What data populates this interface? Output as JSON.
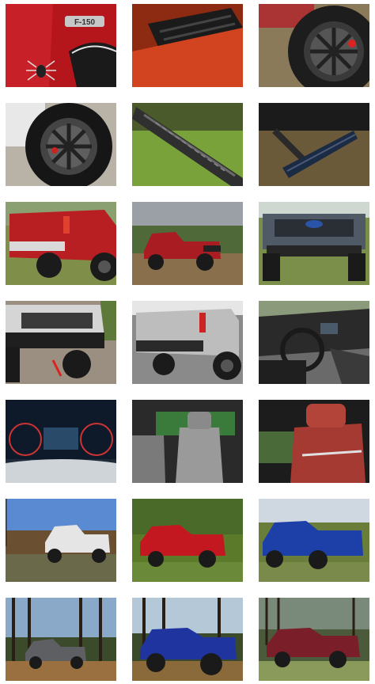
{
  "gallery": {
    "photos": [
      {
        "subject": "truck-fender-emblem",
        "badge": "F-150",
        "colors": {
          "paint": "#b5161c",
          "bg": "#6b1a12"
        }
      },
      {
        "subject": "hood-vent",
        "colors": {
          "paint": "#c4351b",
          "bg": "#7a2a10"
        }
      },
      {
        "subject": "wheel-tire",
        "colors": {
          "paint": "#2b2b2b",
          "bg": "#8a7a5a"
        }
      },
      {
        "subject": "wheel-closeup",
        "colors": {
          "paint": "#1f1f1f",
          "bg": "#b9b2a6"
        }
      },
      {
        "subject": "running-board",
        "colors": {
          "paint": "#3a3a3a",
          "bg": "#7aa23a"
        }
      },
      {
        "subject": "power-step",
        "colors": {
          "paint": "#1c2b44",
          "bg": "#6a5a3a"
        }
      },
      {
        "subject": "red-truck-rear",
        "colors": {
          "paint": "#b71f22",
          "bg": "#7f8f4a"
        }
      },
      {
        "subject": "red-truck-side",
        "colors": {
          "paint": "#a81c22",
          "bg": "#9aa0a6"
        }
      },
      {
        "subject": "gray-truck-front",
        "colors": {
          "paint": "#505a66",
          "bg": "#7b8f4a"
        }
      },
      {
        "subject": "silver-truck-bumper",
        "colors": {
          "paint": "#c9c9c9",
          "bg": "#9a8f80"
        }
      },
      {
        "subject": "silver-truck-rear",
        "colors": {
          "paint": "#bdbdbd",
          "bg": "#8a8a8a"
        }
      },
      {
        "subject": "interior-dash",
        "colors": {
          "paint": "#2a2a2a",
          "bg": "#6a6a6a"
        }
      },
      {
        "subject": "gauge-cluster",
        "colors": {
          "paint": "#0e1a2a",
          "bg": "#1f2a38"
        }
      },
      {
        "subject": "gray-leather-seats",
        "colors": {
          "paint": "#9a9a9a",
          "bg": "#2a2a2a"
        }
      },
      {
        "subject": "red-leather-seats",
        "colors": {
          "paint": "#a53a32",
          "bg": "#1c1c1c"
        }
      },
      {
        "subject": "white-truck-farm",
        "colors": {
          "paint": "#e5e5e5",
          "bg": "#5a8ad2"
        }
      },
      {
        "subject": "red-truck-yard",
        "colors": {
          "paint": "#c3181f",
          "bg": "#5b7a2a"
        }
      },
      {
        "subject": "blue-truck-yard",
        "colors": {
          "paint": "#1d3fa8",
          "bg": "#6a7d3a"
        }
      },
      {
        "subject": "gray-truck-forest",
        "colors": {
          "paint": "#5d5f62",
          "bg": "#3a4a2a"
        }
      },
      {
        "subject": "blue-truck-forest",
        "colors": {
          "paint": "#2034a0",
          "bg": "#3c4a2c"
        }
      },
      {
        "subject": "maroon-truck-forest",
        "colors": {
          "paint": "#7a1e2a",
          "bg": "#4a5a3a"
        }
      }
    ]
  }
}
